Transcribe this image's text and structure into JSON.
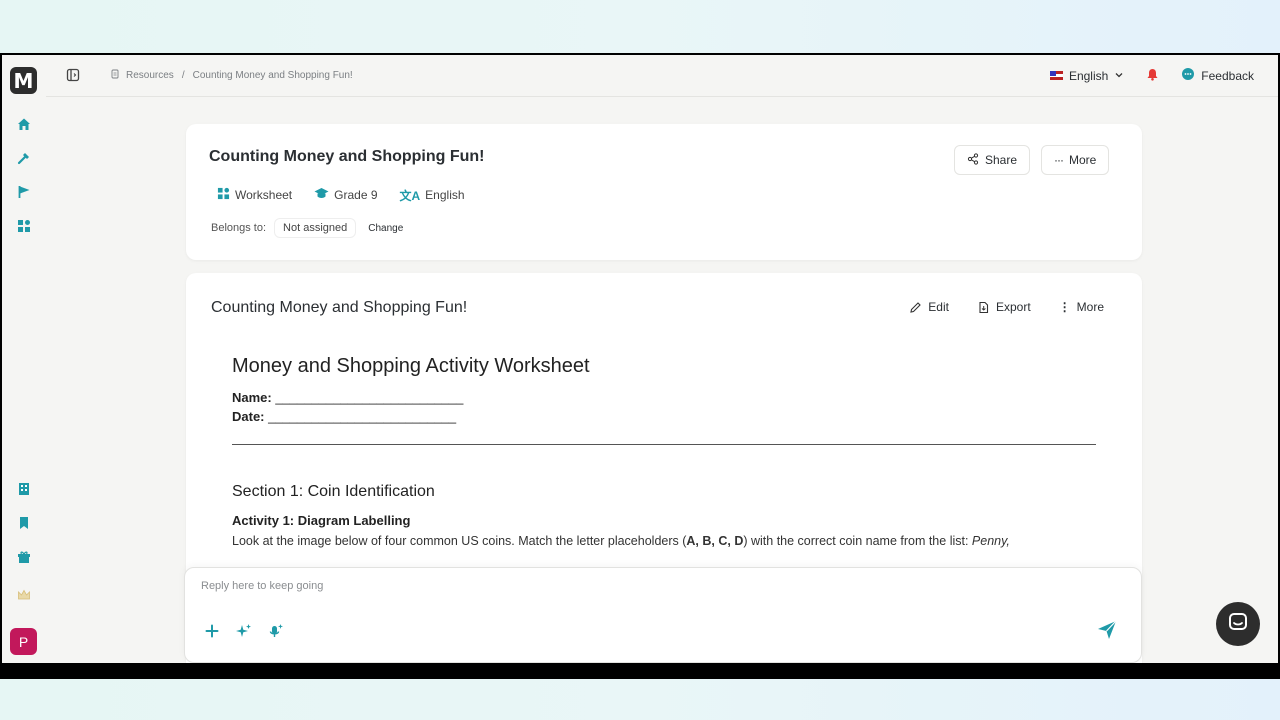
{
  "breadcrumb": {
    "root": "Resources",
    "separator": "/",
    "current": "Counting Money and Shopping Fun!"
  },
  "topbar": {
    "language": "English",
    "feedback": "Feedback"
  },
  "sidebar": {
    "logo": "M",
    "avatar": "P"
  },
  "resource_card": {
    "title": "Counting Money and Shopping Fun!",
    "share_label": "Share",
    "more_label": "More",
    "tags": {
      "type": "Worksheet",
      "grade": "Grade 9",
      "language": "English"
    },
    "belongs_label": "Belongs to:",
    "assignment": "Not assigned",
    "change_label": "Change"
  },
  "content_card": {
    "title": "Counting Money and Shopping Fun!",
    "edit_label": "Edit",
    "export_label": "Export",
    "more_label": "More"
  },
  "document": {
    "heading": "Money and Shopping Activity Worksheet",
    "name_label": "Name:",
    "name_blank": " __________________________",
    "date_label": "Date:",
    "date_blank": " __________________________",
    "section_heading": "Section 1: Coin Identification",
    "activity_heading": "Activity 1: Diagram Labelling",
    "para_start": "Look at the image below of four common US coins. Match the letter placeholders (",
    "para_letters": "A, B, C, D",
    "para_mid": ") with the correct coin name from the list: ",
    "para_italic": "Penny,"
  },
  "composer": {
    "placeholder": "Reply here to keep going"
  },
  "colors": {
    "accent": "#1f9aa8",
    "avatar": "#c2185b",
    "notification": "#e53935"
  }
}
